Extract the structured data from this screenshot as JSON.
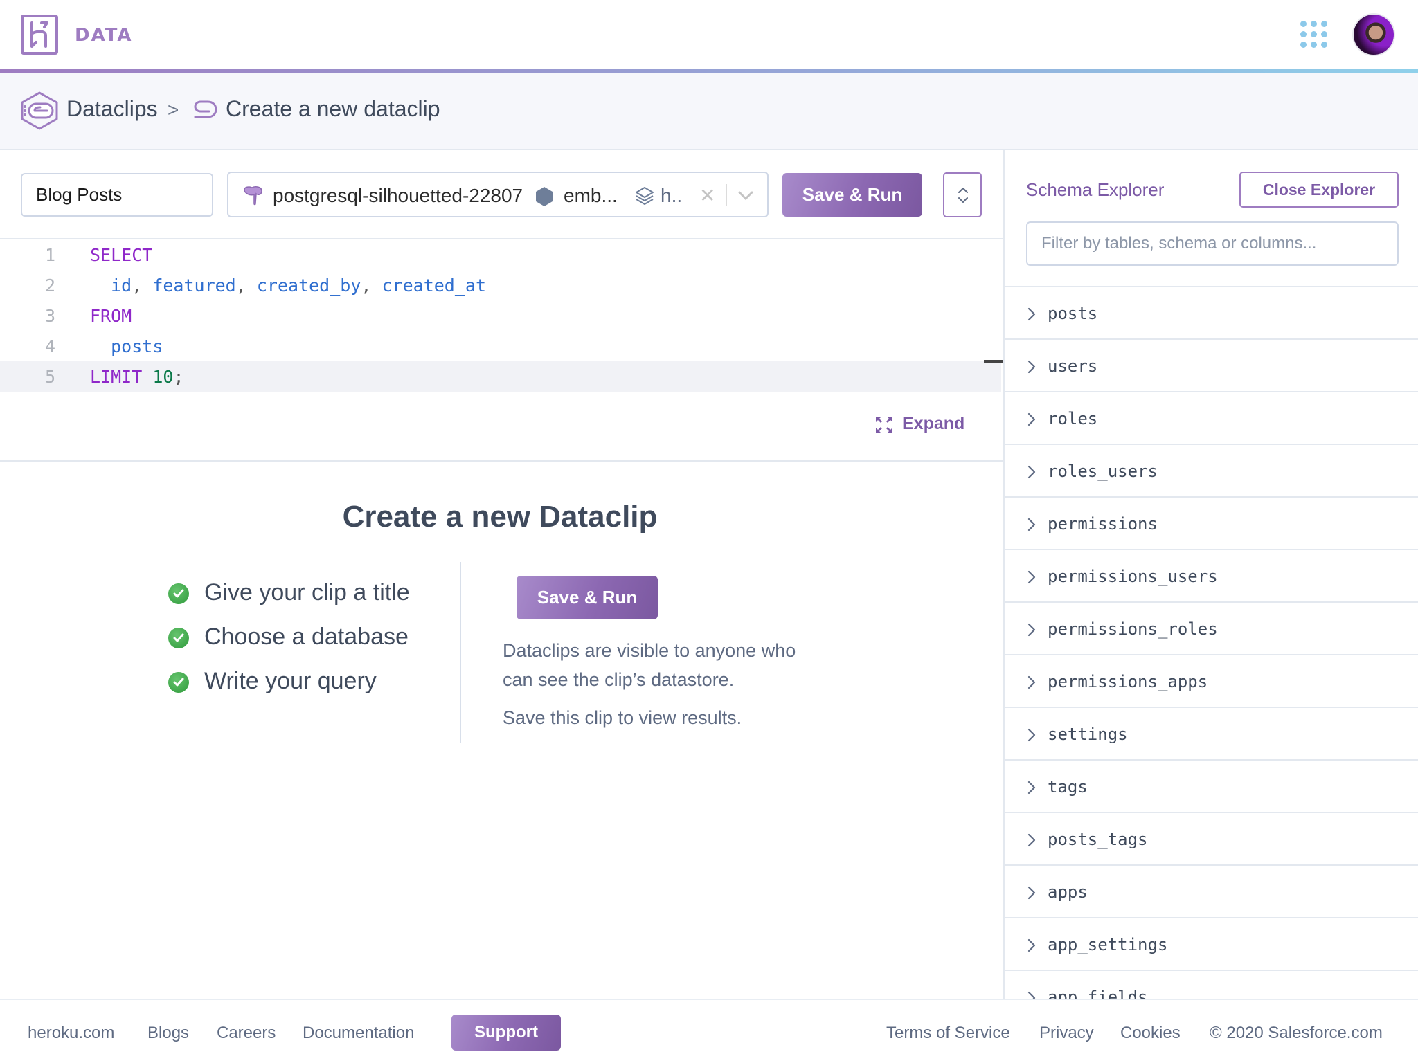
{
  "header": {
    "brand": "DATA",
    "apps_icon": "apps-grid-icon",
    "avatar": "user-avatar"
  },
  "breadcrumb": {
    "root": "Dataclips",
    "separator": ">",
    "current": "Create a new dataclip"
  },
  "toolbar": {
    "title_value": "Blog Posts",
    "database": {
      "name": "postgresql-silhouetted-22807",
      "app": "emb...",
      "space": "h.."
    },
    "save_run_label": "Save & Run"
  },
  "editor": {
    "lines": [
      {
        "n": "1",
        "tokens": [
          {
            "t": "SELECT",
            "c": "kw"
          }
        ]
      },
      {
        "n": "2",
        "tokens": [
          {
            "t": "  ",
            "c": "punc"
          },
          {
            "t": "id",
            "c": "ident"
          },
          {
            "t": ", ",
            "c": "punc"
          },
          {
            "t": "featured",
            "c": "ident"
          },
          {
            "t": ", ",
            "c": "punc"
          },
          {
            "t": "created_by",
            "c": "ident"
          },
          {
            "t": ", ",
            "c": "punc"
          },
          {
            "t": "created_at",
            "c": "ident"
          }
        ]
      },
      {
        "n": "3",
        "tokens": [
          {
            "t": "FROM",
            "c": "kw"
          }
        ]
      },
      {
        "n": "4",
        "tokens": [
          {
            "t": "  ",
            "c": "punc"
          },
          {
            "t": "posts",
            "c": "ident"
          }
        ]
      },
      {
        "n": "5",
        "tokens": [
          {
            "t": "LIMIT",
            "c": "kw"
          },
          {
            "t": " ",
            "c": "punc"
          },
          {
            "t": "10",
            "c": "num"
          },
          {
            "t": ";",
            "c": "punc"
          }
        ]
      }
    ],
    "active_line": 5,
    "expand_label": "Expand"
  },
  "empty_state": {
    "title": "Create a new Dataclip",
    "checklist": [
      "Give your clip a title",
      "Choose a database",
      "Write your query"
    ],
    "save_run_label": "Save & Run",
    "info_line1": "Dataclips are visible to anyone who",
    "info_line2": "can see the clip’s datastore.",
    "info_line3": "Save this clip to view results."
  },
  "schema_explorer": {
    "title": "Schema Explorer",
    "close_label": "Close Explorer",
    "filter_placeholder": "Filter by tables, schema or columns...",
    "tables": [
      "posts",
      "users",
      "roles",
      "roles_users",
      "permissions",
      "permissions_users",
      "permissions_roles",
      "permissions_apps",
      "settings",
      "tags",
      "posts_tags",
      "apps",
      "app_settings",
      "app_fields"
    ]
  },
  "footer": {
    "links": [
      "heroku.com",
      "Blogs",
      "Careers",
      "Documentation"
    ],
    "support_label": "Support",
    "right_links": [
      "Terms of Service",
      "Privacy",
      "Cookies"
    ],
    "copyright": "© 2020 Salesforce.com"
  },
  "colors": {
    "accent": "#9e7cc1",
    "accent_dark": "#7c5aa6",
    "keyword": "#8f28c9",
    "identifier": "#2f6ecf",
    "number": "#0c7a4a",
    "success": "#3ea948"
  }
}
